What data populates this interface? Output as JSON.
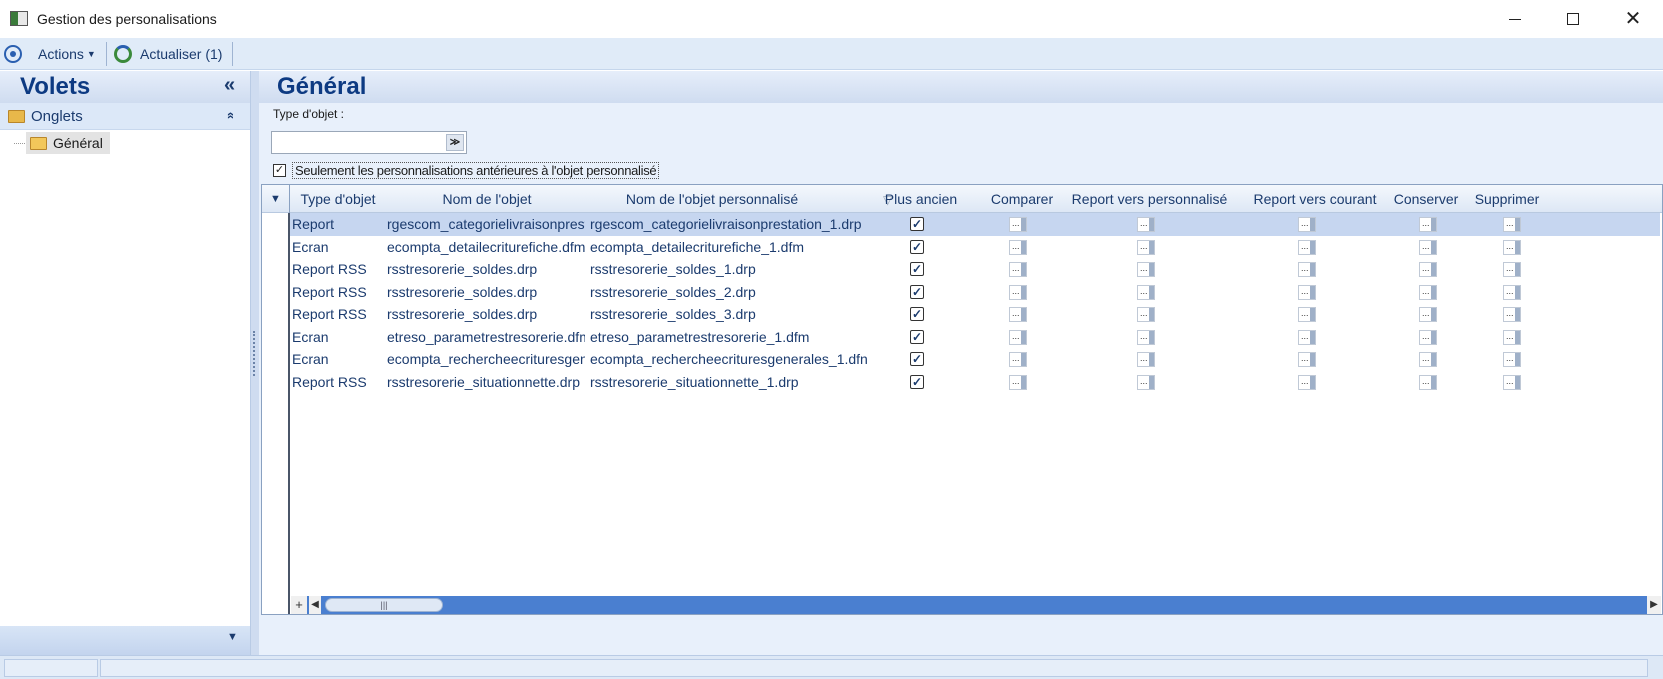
{
  "window": {
    "title": "Gestion des personalisations"
  },
  "toolbar": {
    "actions_label": "Actions",
    "refresh_label": "Actualiser (1)"
  },
  "left_pane": {
    "title": "Volets",
    "collapse_glyph": "«",
    "group_label": "Onglets",
    "group_toggle_glyph": "»",
    "tree_items": [
      {
        "label": "Général"
      }
    ]
  },
  "main": {
    "title": "Général",
    "filter_label": "Type d'objet :",
    "filter_value": "",
    "only_older_checked": true,
    "only_older_label": "Seulement les personnalisations antérieures à l'objet personnalisé"
  },
  "grid": {
    "columns": [
      "Type d'objet",
      "Nom de l'objet",
      "Nom de l'objet personnalisé",
      "Plus ancien",
      "Comparer",
      "Report vers personnalisé",
      "Report vers courant",
      "Conserver",
      "Supprimer"
    ],
    "ellipsis_label": "...",
    "rows": [
      {
        "type": "Report",
        "name": "rgescom_categorielivraisonprestation.drp",
        "personalized": "rgescom_categorielivraisonprestation_1.drp",
        "older": true,
        "selected": true
      },
      {
        "type": "Ecran",
        "name": "ecompta_detailecriturefiche.dfm",
        "personalized": "ecompta_detailecriturefiche_1.dfm",
        "older": true,
        "selected": false
      },
      {
        "type": "Report RSS",
        "name": "rsstresorerie_soldes.drp",
        "personalized": "rsstresorerie_soldes_1.drp",
        "older": true,
        "selected": false
      },
      {
        "type": "Report RSS",
        "name": "rsstresorerie_soldes.drp",
        "personalized": "rsstresorerie_soldes_2.drp",
        "older": true,
        "selected": false
      },
      {
        "type": "Report RSS",
        "name": "rsstresorerie_soldes.drp",
        "personalized": "rsstresorerie_soldes_3.drp",
        "older": true,
        "selected": false
      },
      {
        "type": "Ecran",
        "name": "etreso_parametrestresorerie.dfm",
        "personalized": "etreso_parametrestresorerie_1.dfm",
        "older": true,
        "selected": false
      },
      {
        "type": "Ecran",
        "name": "ecompta_rechercheecrituresgenerales.dfm",
        "personalized": "ecompta_rechercheecrituresgenerales_1.dfn",
        "older": true,
        "selected": false
      },
      {
        "type": "Report RSS",
        "name": "rsstresorerie_situationnette.drp",
        "personalized": "rsstresorerie_situationnette_1.drp",
        "older": true,
        "selected": false
      }
    ]
  },
  "colors": {
    "accent": "#0d3a82",
    "selection": "#c6d6f0",
    "scrollbar": "#4a7fd0"
  }
}
